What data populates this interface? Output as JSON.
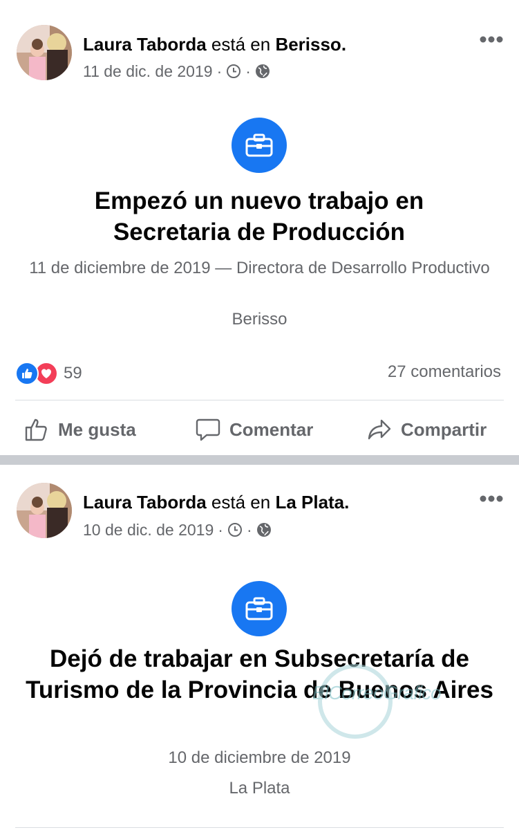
{
  "posts": [
    {
      "author": "Laura Taborda",
      "location_prefix": "está en",
      "location": "Berisso",
      "date": "11 de dic. de 2019",
      "event_title": "Empezó un nuevo trabajo en Secretaria de Producción",
      "event_detail": "11 de diciembre de 2019 —  Directora de Desarrollo Productivo",
      "event_place": "Berisso",
      "reaction_count": "59",
      "comments": "27 comentarios",
      "actions": {
        "like": "Me gusta",
        "comment": "Comentar",
        "share": "Compartir"
      }
    },
    {
      "author": "Laura Taborda",
      "location_prefix": "está en",
      "location": "La Plata",
      "date": "10 de dic. de 2019",
      "event_title": "Dejó de trabajar en Subsecretaría de Turismo de la Provincia de Buenos Aires",
      "event_detail": "10 de diciembre de 2019",
      "event_place": "La Plata"
    }
  ],
  "watermark": "ElCorreoGrafico",
  "icons": {
    "clock": "clock-icon",
    "globe": "globe-icon",
    "more": "more-options-icon",
    "briefcase": "briefcase-icon",
    "like_reaction": "like-reaction-icon",
    "love_reaction": "love-reaction-icon",
    "thumb": "thumbs-up-icon",
    "speech": "comment-bubble-icon",
    "share": "share-arrow-icon"
  },
  "colors": {
    "brand_blue": "#1877f2",
    "love_red": "#f33e58",
    "secondary_text": "#65676b",
    "separator": "#c9ccd1"
  }
}
